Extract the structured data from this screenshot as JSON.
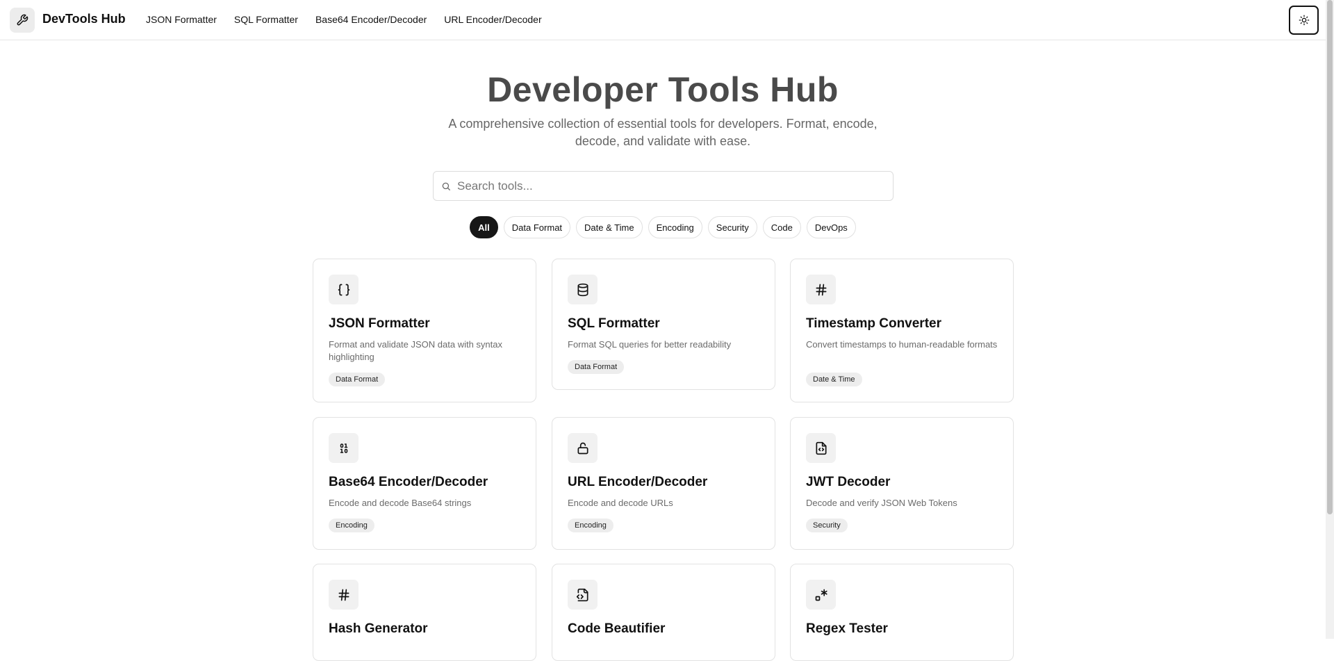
{
  "header": {
    "brand": "DevTools Hub",
    "nav": [
      "JSON Formatter",
      "SQL Formatter",
      "Base64 Encoder/Decoder",
      "URL Encoder/Decoder"
    ]
  },
  "hero": {
    "title": "Developer Tools Hub",
    "subtitle": "A comprehensive collection of essential tools for developers. Format, encode, decode, and validate with ease."
  },
  "search": {
    "placeholder": "Search tools..."
  },
  "filters": {
    "active": "All",
    "items": [
      "All",
      "Data Format",
      "Date & Time",
      "Encoding",
      "Security",
      "Code",
      "DevOps"
    ]
  },
  "tools": [
    {
      "title": "JSON Formatter",
      "desc": "Format and validate JSON data with syntax highlighting",
      "tag": "Data Format",
      "icon": "braces-icon"
    },
    {
      "title": "SQL Formatter",
      "desc": "Format SQL queries for better readability",
      "tag": "Data Format",
      "icon": "database-icon"
    },
    {
      "title": "Timestamp Converter",
      "desc": "Convert timestamps to human-readable formats",
      "tag": "Date & Time",
      "icon": "hash-icon"
    },
    {
      "title": "Base64 Encoder/Decoder",
      "desc": "Encode and decode Base64 strings",
      "tag": "Encoding",
      "icon": "binary-icon"
    },
    {
      "title": "URL Encoder/Decoder",
      "desc": "Encode and decode URLs",
      "tag": "Encoding",
      "icon": "lock-icon"
    },
    {
      "title": "JWT Decoder",
      "desc": "Decode and verify JSON Web Tokens",
      "tag": "Security",
      "icon": "file-code-icon"
    },
    {
      "title": "Hash Generator",
      "desc": "",
      "tag": "",
      "icon": "hash-icon"
    },
    {
      "title": "Code Beautifier",
      "desc": "",
      "tag": "",
      "icon": "file-code-icon"
    },
    {
      "title": "Regex Tester",
      "desc": "",
      "tag": "",
      "icon": "regex-icon"
    }
  ]
}
